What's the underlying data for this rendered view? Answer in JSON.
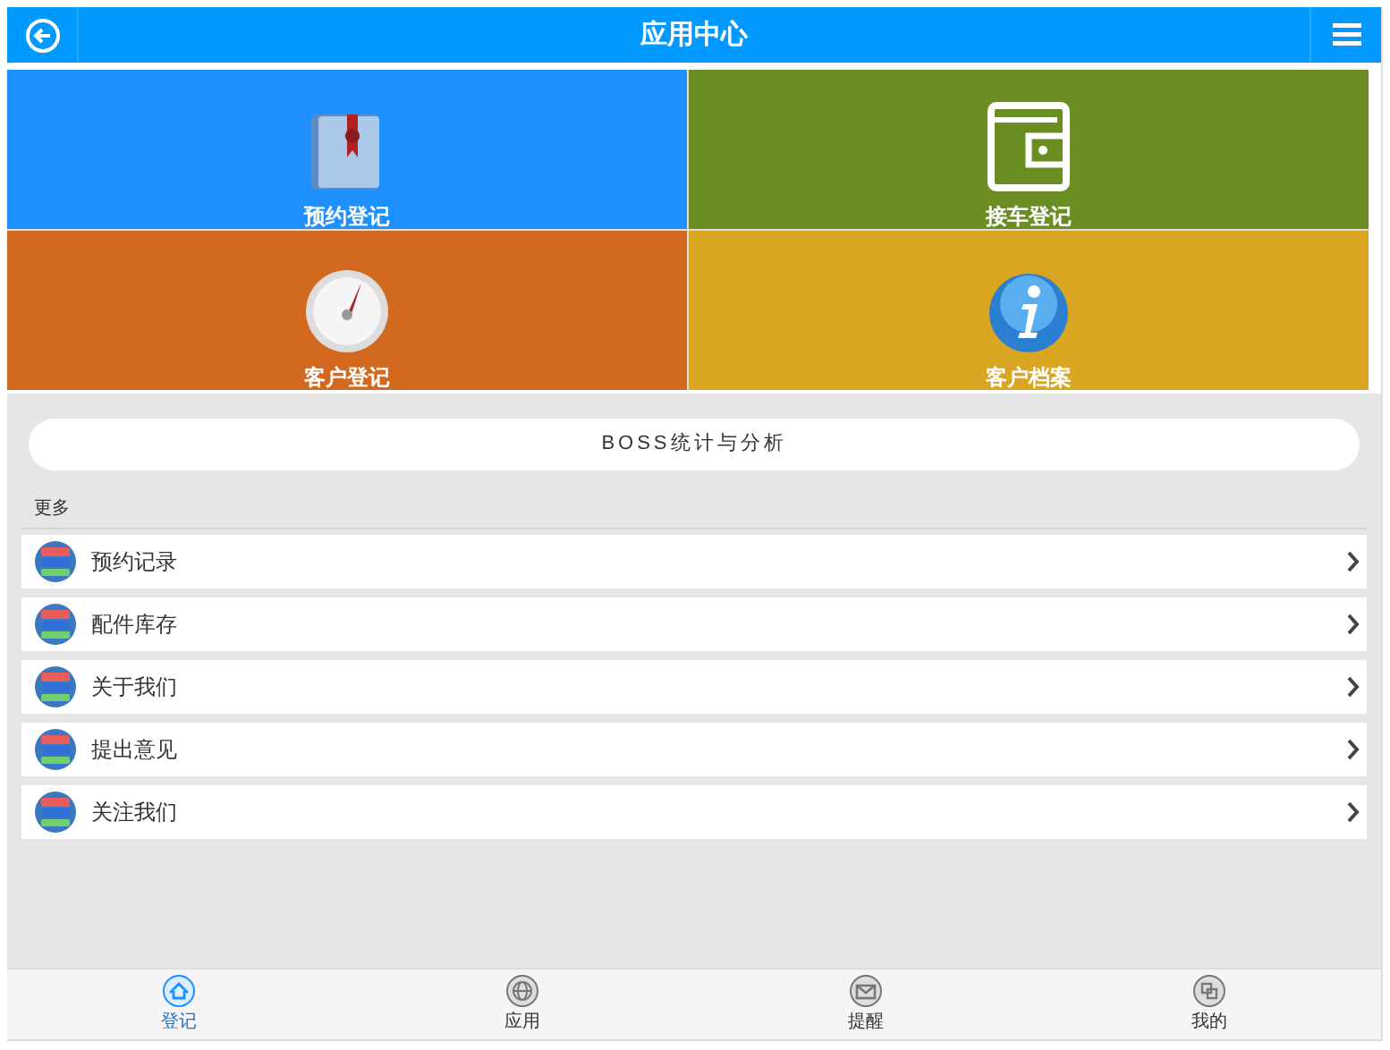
{
  "header": {
    "title": "应用中心"
  },
  "tiles": [
    {
      "label": "预约登记",
      "kind": "book",
      "color": "#1e90ff"
    },
    {
      "label": "接车登记",
      "kind": "wallet",
      "color": "#6b8e23"
    },
    {
      "label": "客户登记",
      "kind": "gauge",
      "color": "#d2691e"
    },
    {
      "label": "客户档案",
      "kind": "info",
      "color": "#daa520"
    }
  ],
  "boss_button": "BOSS统计与分析",
  "section_label": "更多",
  "list_items": [
    "预约记录",
    "配件库存",
    "关于我们",
    "提出意见",
    "关注我们"
  ],
  "tab_bar": [
    {
      "label": "登记",
      "kind": "home",
      "selected": true
    },
    {
      "label": "应用",
      "kind": "globe",
      "selected": false
    },
    {
      "label": "提醒",
      "kind": "mail",
      "selected": false
    },
    {
      "label": "我的",
      "kind": "user",
      "selected": false
    }
  ]
}
